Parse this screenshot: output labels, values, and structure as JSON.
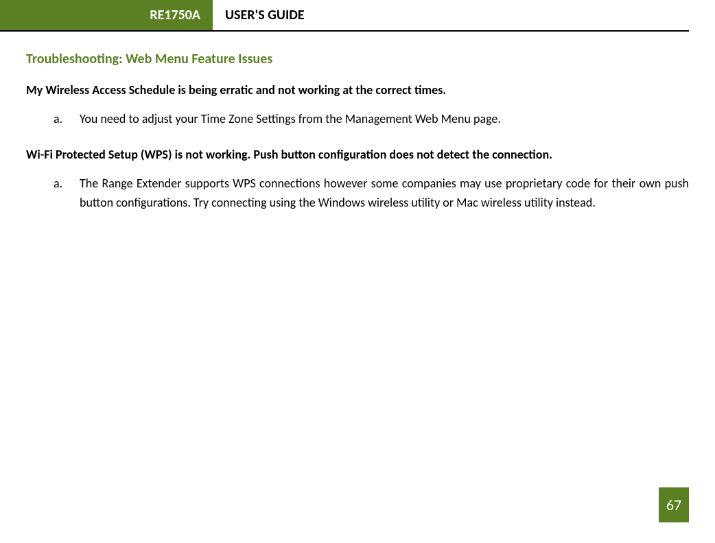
{
  "header": {
    "model": "RE1750A",
    "title": "USER'S GUIDE"
  },
  "section_title": "Troubleshooting: Web Menu Feature Issues",
  "issues": [
    {
      "heading": "My Wireless Access Schedule is being erratic and not working at the correct times.",
      "items": [
        {
          "marker": "a.",
          "text": "You need to adjust your Time Zone Settings from the Management Web Menu page."
        }
      ]
    },
    {
      "heading": "Wi-Fi Protected Setup (WPS) is not working. Push button configuration does not detect the connection.",
      "items": [
        {
          "marker": "a.",
          "text": "The Range Extender supports WPS connections however some companies may use proprietary code for their own push button configurations. Try connecting using the Windows wireless utility or Mac wireless utility instead."
        }
      ]
    }
  ],
  "page_number": "67"
}
